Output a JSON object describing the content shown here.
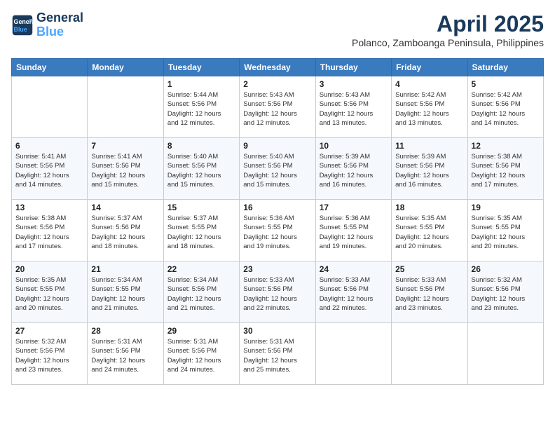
{
  "header": {
    "logo_line1": "General",
    "logo_line2": "Blue",
    "month": "April 2025",
    "location": "Polanco, Zamboanga Peninsula, Philippines"
  },
  "weekdays": [
    "Sunday",
    "Monday",
    "Tuesday",
    "Wednesday",
    "Thursday",
    "Friday",
    "Saturday"
  ],
  "weeks": [
    [
      {
        "day": "",
        "info": ""
      },
      {
        "day": "",
        "info": ""
      },
      {
        "day": "1",
        "info": "Sunrise: 5:44 AM\nSunset: 5:56 PM\nDaylight: 12 hours\nand 12 minutes."
      },
      {
        "day": "2",
        "info": "Sunrise: 5:43 AM\nSunset: 5:56 PM\nDaylight: 12 hours\nand 12 minutes."
      },
      {
        "day": "3",
        "info": "Sunrise: 5:43 AM\nSunset: 5:56 PM\nDaylight: 12 hours\nand 13 minutes."
      },
      {
        "day": "4",
        "info": "Sunrise: 5:42 AM\nSunset: 5:56 PM\nDaylight: 12 hours\nand 13 minutes."
      },
      {
        "day": "5",
        "info": "Sunrise: 5:42 AM\nSunset: 5:56 PM\nDaylight: 12 hours\nand 14 minutes."
      }
    ],
    [
      {
        "day": "6",
        "info": "Sunrise: 5:41 AM\nSunset: 5:56 PM\nDaylight: 12 hours\nand 14 minutes."
      },
      {
        "day": "7",
        "info": "Sunrise: 5:41 AM\nSunset: 5:56 PM\nDaylight: 12 hours\nand 15 minutes."
      },
      {
        "day": "8",
        "info": "Sunrise: 5:40 AM\nSunset: 5:56 PM\nDaylight: 12 hours\nand 15 minutes."
      },
      {
        "day": "9",
        "info": "Sunrise: 5:40 AM\nSunset: 5:56 PM\nDaylight: 12 hours\nand 15 minutes."
      },
      {
        "day": "10",
        "info": "Sunrise: 5:39 AM\nSunset: 5:56 PM\nDaylight: 12 hours\nand 16 minutes."
      },
      {
        "day": "11",
        "info": "Sunrise: 5:39 AM\nSunset: 5:56 PM\nDaylight: 12 hours\nand 16 minutes."
      },
      {
        "day": "12",
        "info": "Sunrise: 5:38 AM\nSunset: 5:56 PM\nDaylight: 12 hours\nand 17 minutes."
      }
    ],
    [
      {
        "day": "13",
        "info": "Sunrise: 5:38 AM\nSunset: 5:56 PM\nDaylight: 12 hours\nand 17 minutes."
      },
      {
        "day": "14",
        "info": "Sunrise: 5:37 AM\nSunset: 5:56 PM\nDaylight: 12 hours\nand 18 minutes."
      },
      {
        "day": "15",
        "info": "Sunrise: 5:37 AM\nSunset: 5:55 PM\nDaylight: 12 hours\nand 18 minutes."
      },
      {
        "day": "16",
        "info": "Sunrise: 5:36 AM\nSunset: 5:55 PM\nDaylight: 12 hours\nand 19 minutes."
      },
      {
        "day": "17",
        "info": "Sunrise: 5:36 AM\nSunset: 5:55 PM\nDaylight: 12 hours\nand 19 minutes."
      },
      {
        "day": "18",
        "info": "Sunrise: 5:35 AM\nSunset: 5:55 PM\nDaylight: 12 hours\nand 20 minutes."
      },
      {
        "day": "19",
        "info": "Sunrise: 5:35 AM\nSunset: 5:55 PM\nDaylight: 12 hours\nand 20 minutes."
      }
    ],
    [
      {
        "day": "20",
        "info": "Sunrise: 5:35 AM\nSunset: 5:55 PM\nDaylight: 12 hours\nand 20 minutes."
      },
      {
        "day": "21",
        "info": "Sunrise: 5:34 AM\nSunset: 5:55 PM\nDaylight: 12 hours\nand 21 minutes."
      },
      {
        "day": "22",
        "info": "Sunrise: 5:34 AM\nSunset: 5:56 PM\nDaylight: 12 hours\nand 21 minutes."
      },
      {
        "day": "23",
        "info": "Sunrise: 5:33 AM\nSunset: 5:56 PM\nDaylight: 12 hours\nand 22 minutes."
      },
      {
        "day": "24",
        "info": "Sunrise: 5:33 AM\nSunset: 5:56 PM\nDaylight: 12 hours\nand 22 minutes."
      },
      {
        "day": "25",
        "info": "Sunrise: 5:33 AM\nSunset: 5:56 PM\nDaylight: 12 hours\nand 23 minutes."
      },
      {
        "day": "26",
        "info": "Sunrise: 5:32 AM\nSunset: 5:56 PM\nDaylight: 12 hours\nand 23 minutes."
      }
    ],
    [
      {
        "day": "27",
        "info": "Sunrise: 5:32 AM\nSunset: 5:56 PM\nDaylight: 12 hours\nand 23 minutes."
      },
      {
        "day": "28",
        "info": "Sunrise: 5:31 AM\nSunset: 5:56 PM\nDaylight: 12 hours\nand 24 minutes."
      },
      {
        "day": "29",
        "info": "Sunrise: 5:31 AM\nSunset: 5:56 PM\nDaylight: 12 hours\nand 24 minutes."
      },
      {
        "day": "30",
        "info": "Sunrise: 5:31 AM\nSunset: 5:56 PM\nDaylight: 12 hours\nand 25 minutes."
      },
      {
        "day": "",
        "info": ""
      },
      {
        "day": "",
        "info": ""
      },
      {
        "day": "",
        "info": ""
      }
    ]
  ]
}
